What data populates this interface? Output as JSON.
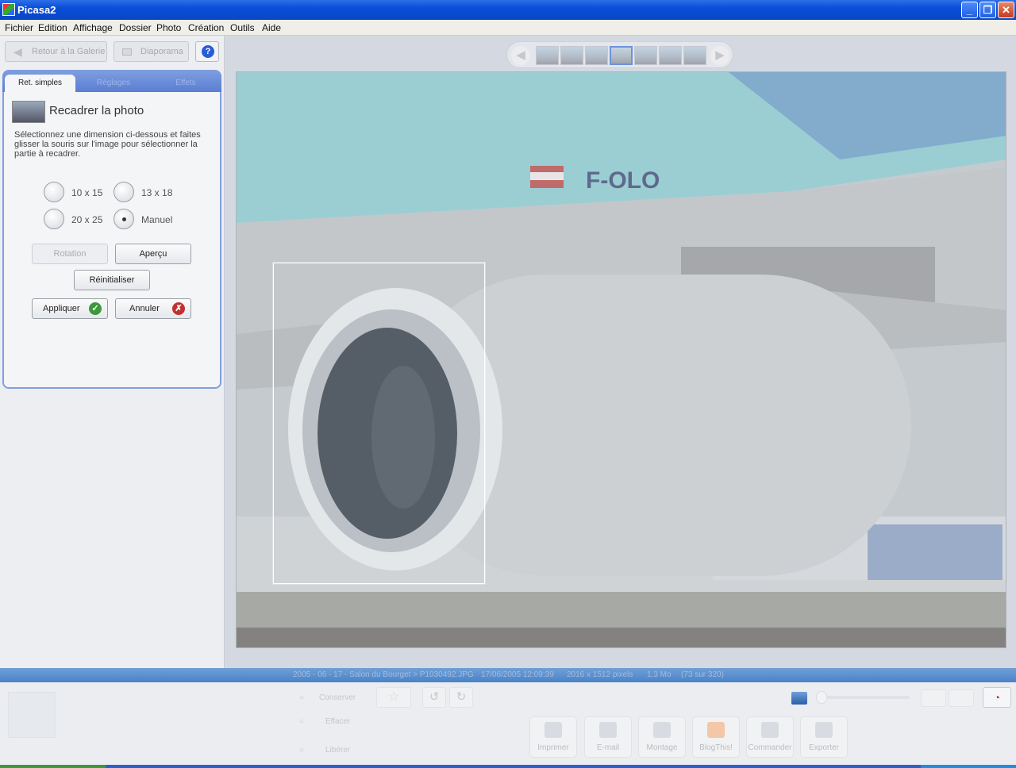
{
  "window": {
    "title": "Picasa2",
    "min_icon": "minimize-icon",
    "max_icon": "restore-icon",
    "close_icon": "close-icon"
  },
  "menu": [
    "Fichier",
    "Edition",
    "Affichage",
    "Dossier",
    "Photo",
    "Création",
    "Outils",
    "Aide"
  ],
  "toolbar": {
    "back_label": "Retour à la Galerie",
    "slideshow_label": "Diaporama",
    "help": "?"
  },
  "tabs": [
    {
      "label": "Ret. simples",
      "active": true
    },
    {
      "label": "Réglages",
      "active": false
    },
    {
      "label": "Effets",
      "active": false
    }
  ],
  "crop": {
    "title": "Recadrer la photo",
    "description": "Sélectionnez une dimension ci-dessous et faites glisser la souris sur l'image pour sélectionner la partie à recadrer.",
    "options": [
      {
        "label": "10 x 15",
        "selected": false
      },
      {
        "label": "13 x 18",
        "selected": false
      },
      {
        "label": "20 x 25",
        "selected": false
      },
      {
        "label": "Manuel",
        "selected": true
      }
    ],
    "rotation_label": "Rotation",
    "preview_label": "Aperçu",
    "reset_label": "Réinitialiser",
    "apply_label": "Appliquer",
    "cancel_label": "Annuler"
  },
  "photo": {
    "registration_text": "F-OLO"
  },
  "infobar": {
    "path": "2005 - 06 - 17 - Salon du Bourget > P1030492.JPG",
    "date": "17/06/2005 12:09:39",
    "dimensions": "2016 x 1512 pixels",
    "size": "1,3 Mo",
    "position": "(73 sur 320)"
  },
  "bottom": {
    "small_labels": [
      "Conserver",
      "Effacer",
      "Libérer"
    ],
    "actions": [
      "Imprimer",
      "E-mail",
      "Montage",
      "BlogThis!",
      "Commander",
      "Exporter"
    ]
  },
  "colors": {
    "titlebar": "#0a4ed8",
    "tab_accent": "#7f9fe0",
    "apply": "#3c9a3c",
    "cancel": "#c03030"
  }
}
